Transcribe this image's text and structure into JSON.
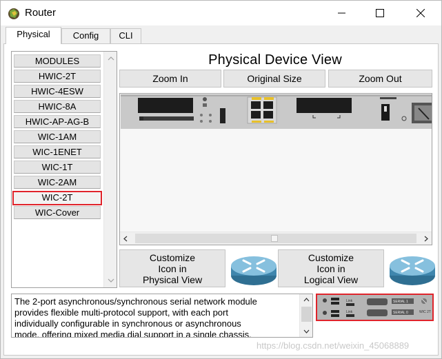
{
  "window": {
    "title": "Router",
    "controls": [
      "minimize-icon",
      "maximize-icon",
      "close-icon"
    ]
  },
  "tabs": [
    {
      "label": "Physical",
      "active": true
    },
    {
      "label": "Config",
      "active": false
    },
    {
      "label": "CLI",
      "active": false
    }
  ],
  "modules": {
    "items": [
      "MODULES",
      "HWIC-2T",
      "HWIC-4ESW",
      "HWIC-8A",
      "HWIC-AP-AG-B",
      "WIC-1AM",
      "WIC-1ENET",
      "WIC-1T",
      "WIC-2AM",
      "WIC-2T",
      "WIC-Cover"
    ],
    "selected": "WIC-2T"
  },
  "physical_view": {
    "title": "Physical Device View",
    "zoom_in": "Zoom In",
    "original_size": "Original Size",
    "zoom_out": "Zoom Out"
  },
  "customize": {
    "physical": [
      "Customize",
      "Icon in",
      "Physical View"
    ],
    "logical": [
      "Customize",
      "Icon in",
      "Logical View"
    ]
  },
  "description": {
    "text": "The 2-port asynchronous/synchronous serial network module\n provides flexible multi-protocol support, with each port\nindividually configurable in synchronous or asynchronous\nmode, offering mixed media dial support in a single chassis."
  },
  "module_image_labels": [
    "Link",
    "Link",
    "SERIAL 1",
    "SERIAL 0",
    "WIC 2T"
  ],
  "watermark": "https://blog.csdn.net/weixin_45068889",
  "colors": {
    "selection_border": "#e0242b",
    "router_icon_blue": "#3f86ad"
  }
}
